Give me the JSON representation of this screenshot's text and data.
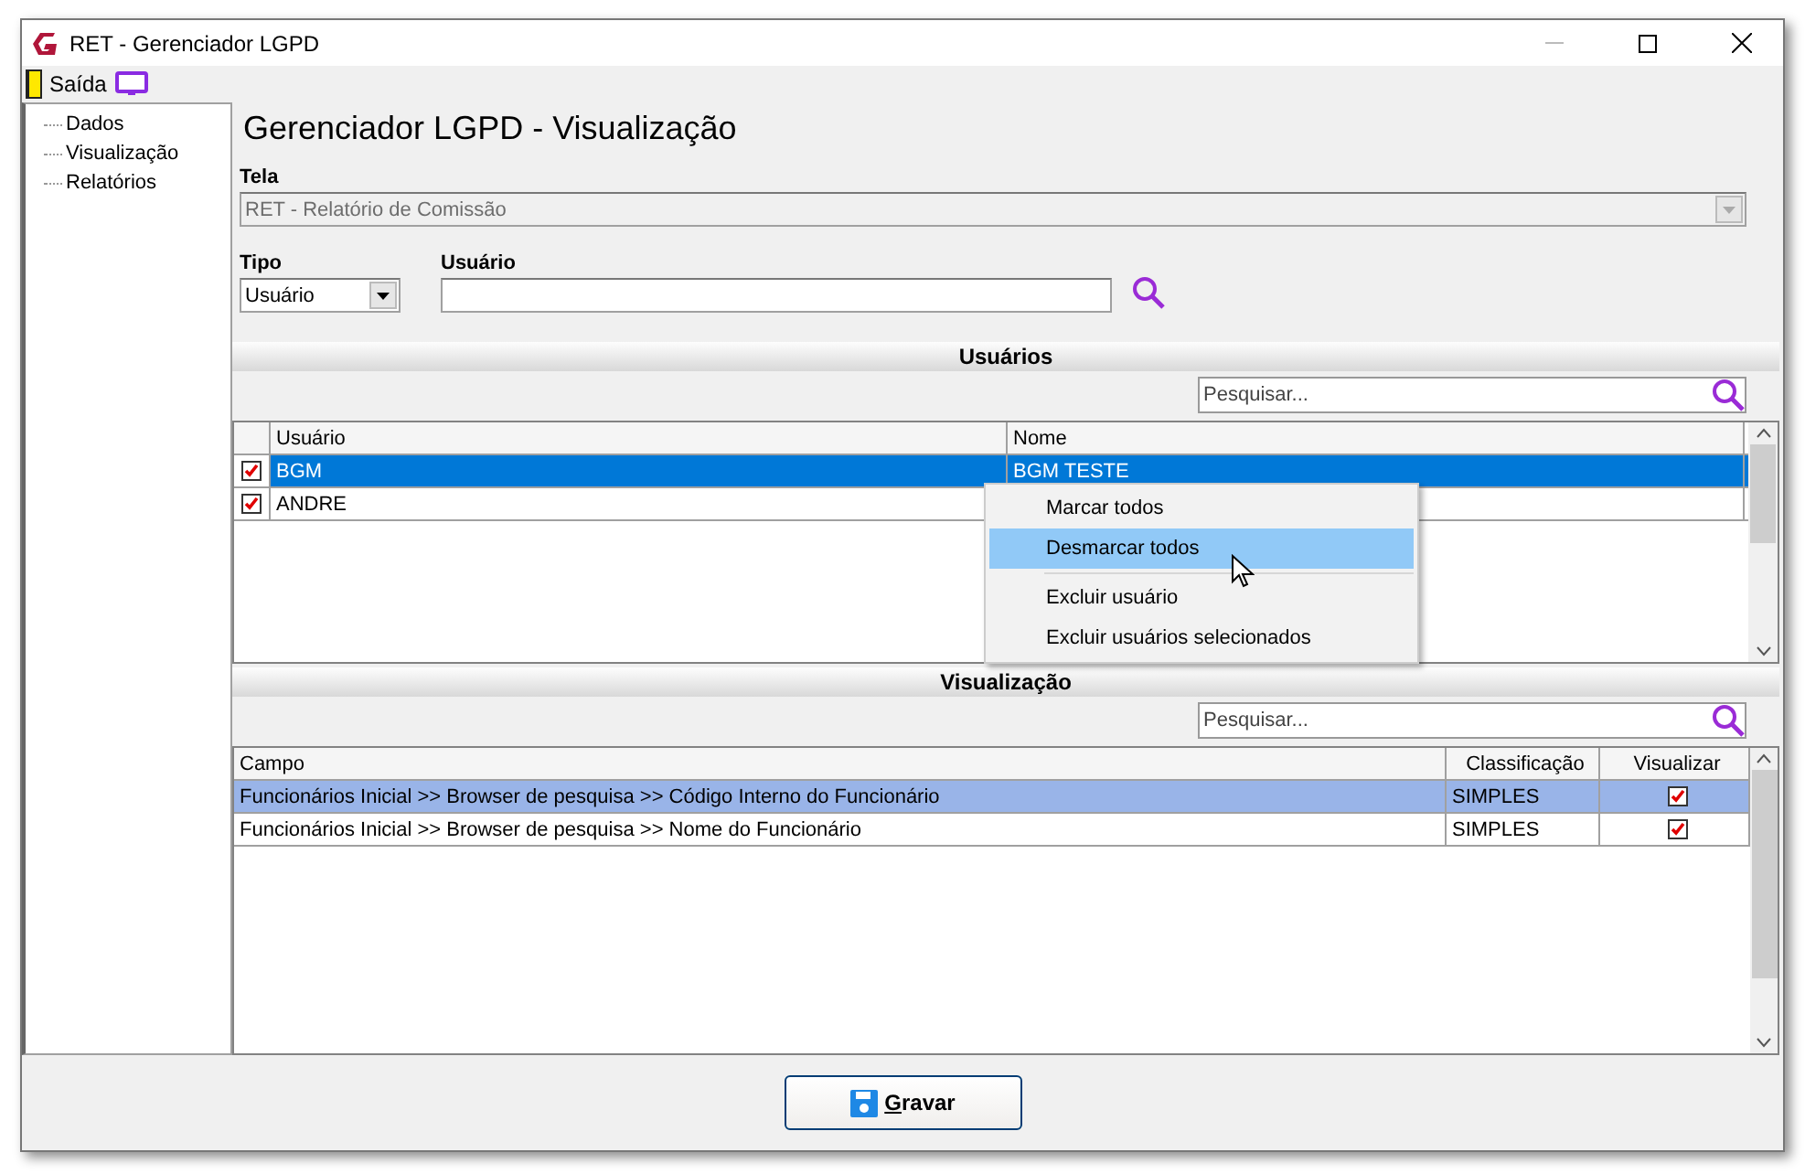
{
  "window": {
    "title": "RET - Gerenciador LGPD"
  },
  "toolbar": {
    "exit_label": "Saída"
  },
  "sidebar": {
    "items": [
      {
        "label": "Dados",
        "selected": false
      },
      {
        "label": "Visualização",
        "selected": false
      },
      {
        "label": "Relatórios",
        "selected": false
      }
    ]
  },
  "heading": "Gerenciador LGPD - Visualização",
  "tela": {
    "label": "Tela",
    "value": "RET - Relatório de Comissão",
    "disabled": true
  },
  "tipo": {
    "label": "Tipo",
    "value": "Usuário"
  },
  "usuario": {
    "label": "Usuário"
  },
  "users_section": {
    "title": "Usuários",
    "search_placeholder": "Pesquisar...",
    "columns": [
      "Usuário",
      "Nome"
    ],
    "rows": [
      {
        "checked": true,
        "selected": true,
        "cells": [
          "BGM",
          "BGM TESTE"
        ]
      },
      {
        "checked": true,
        "selected": false,
        "cells": [
          "ANDRE",
          ""
        ]
      }
    ]
  },
  "context_menu": {
    "items": [
      {
        "kind": "item",
        "label": "Marcar todos",
        "selected": false
      },
      {
        "kind": "item",
        "label": "Desmarcar todos",
        "selected": true
      },
      {
        "kind": "separator"
      },
      {
        "kind": "item",
        "label": "Excluir usuário",
        "selected": false
      },
      {
        "kind": "item",
        "label": "Excluir usuários selecionados",
        "selected": false
      }
    ]
  },
  "view_section": {
    "title": "Visualização",
    "search_placeholder": "Pesquisar...",
    "columns": [
      "Campo",
      "Classificação",
      "Visualizar"
    ],
    "rows": [
      {
        "selected": true,
        "campo": "Funcionários Inicial >> Browser de pesquisa >> Código Interno do Funcionário",
        "classificacao": "SIMPLES",
        "checked": true
      },
      {
        "selected": false,
        "campo": "Funcionários Inicial >> Browser de pesquisa >> Nome do Funcionário",
        "classificacao": "SIMPLES",
        "checked": true
      }
    ]
  },
  "save_button": {
    "mnemonic": "G",
    "rest": "ravar"
  }
}
